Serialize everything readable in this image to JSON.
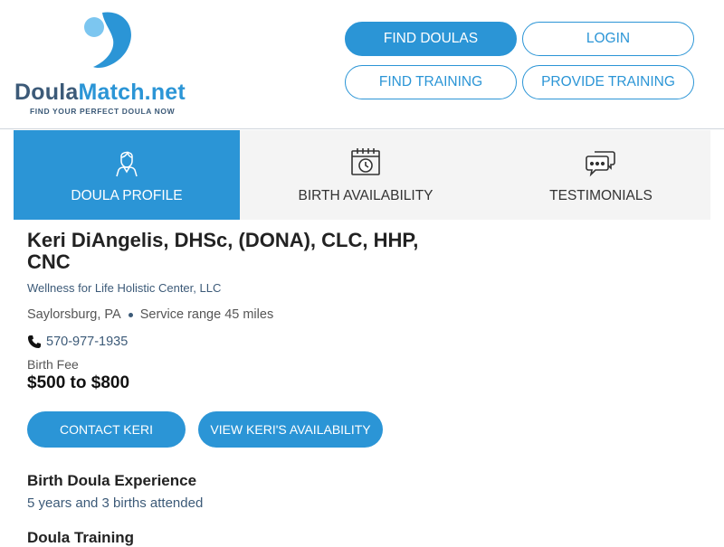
{
  "brand": {
    "name_part1": "Doula",
    "name_part2": "Match.net",
    "tagline": "FIND YOUR PERFECT DOULA NOW",
    "accent_color": "#2b95d6",
    "dark_color": "#3c5a78"
  },
  "nav": {
    "find_doulas": "FIND DOULAS",
    "login": "LOGIN",
    "find_training": "FIND TRAINING",
    "provide_training": "PROVIDE TRAINING"
  },
  "tabs": [
    {
      "label": "DOULA PROFILE",
      "icon": "person-icon",
      "active": true
    },
    {
      "label": "BIRTH AVAILABILITY",
      "icon": "calendar-clock-icon",
      "active": false
    },
    {
      "label": "TESTIMONIALS",
      "icon": "chat-bubbles-icon",
      "active": false
    }
  ],
  "profile": {
    "name": "Keri DiAngelis, DHSc, (DONA), CLC, HHP, CNC",
    "organization": "Wellness for Life Holistic Center, LLC",
    "location": "Saylorsburg, PA",
    "service_range": "Service range 45 miles",
    "phone": "570-977-1935",
    "fee_label": "Birth Fee",
    "fee": "$500 to $800",
    "contact_button": "CONTACT KERI",
    "availability_button": "VIEW KERI'S AVAILABILITY",
    "experience_title": "Birth Doula Experience",
    "experience_text": "5 years and 3 births attended",
    "training_title": "Doula Training"
  }
}
